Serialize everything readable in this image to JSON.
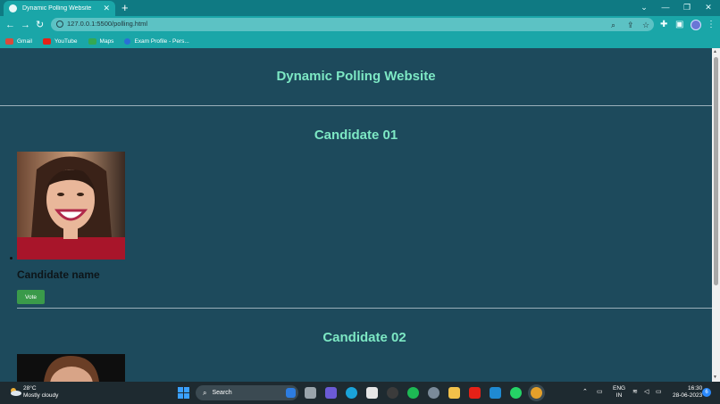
{
  "browser": {
    "tab_title": "Dynamic Polling Website",
    "tab_close": "✕",
    "new_tab": "+",
    "url": "127.0.0.1:5500/polling.html",
    "bookmarks": [
      {
        "label": "Gmail",
        "icon": "gmail-icon",
        "color": "#d94a3c"
      },
      {
        "label": "YouTube",
        "icon": "youtube-icon",
        "color": "#e62117"
      },
      {
        "label": "Maps",
        "icon": "maps-icon",
        "color": "#34a853"
      },
      {
        "label": "Exam Profile - Pers...",
        "icon": "exam-icon",
        "color": "#2a6fd6"
      }
    ]
  },
  "page": {
    "heading": "Dynamic Polling Website",
    "candidates": [
      {
        "title": "Candidate 01",
        "name": "Candidate name",
        "vote_label": "Vote"
      },
      {
        "title": "Candidate 02"
      }
    ]
  },
  "taskbar": {
    "temperature": "28°C",
    "weather": "Mostly cloudy",
    "search_label": "Search",
    "lang_top": "ENG",
    "lang_bottom": "IN",
    "time": "16:30",
    "date": "28-06-2023",
    "notifications": "6"
  },
  "colors": {
    "accent_heading": "#7de8c4",
    "page_bg": "#1d4a5c",
    "chrome": "#1aa6a8",
    "vote_button": "#3a9a4a"
  }
}
